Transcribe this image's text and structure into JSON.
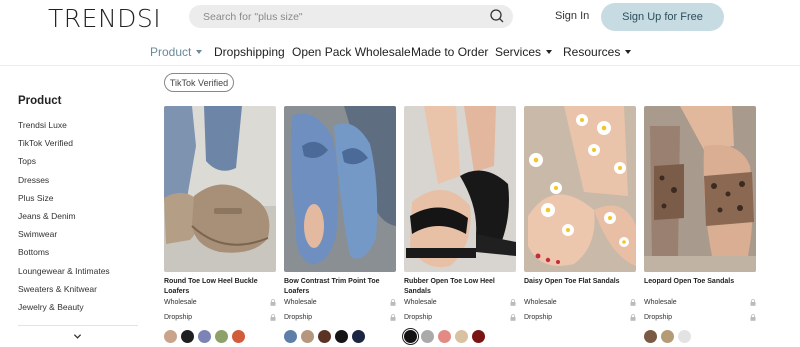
{
  "header": {
    "logo": "TRENDSI",
    "search_placeholder": "Search for \"plus size\"",
    "signin_label": "Sign In",
    "signup_label": "Sign Up for Free"
  },
  "nav": {
    "items": [
      {
        "label": "Product",
        "has_caret": true,
        "active": true
      },
      {
        "label": "Dropshipping",
        "has_caret": false
      },
      {
        "label": "Open Pack Wholesale",
        "has_caret": false
      },
      {
        "label": "Made to Order",
        "has_caret": false
      },
      {
        "label": "Services",
        "has_caret": true
      },
      {
        "label": "Resources",
        "has_caret": true
      }
    ]
  },
  "filter_chip": "TikTok Verified",
  "sidebar": {
    "title": "Product",
    "items": [
      "Trendsi Luxe",
      "TikTok Verified",
      "Tops",
      "Dresses",
      "Plus Size",
      "Jeans & Denim",
      "Swimwear",
      "Bottoms",
      "Loungewear & Intimates",
      "Sweaters & Knitwear",
      "Jewelry & Beauty"
    ]
  },
  "products": [
    {
      "title": "Round Toe Low Heel Buckle Loafers",
      "wholesale_label": "Wholesale",
      "dropship_label": "Dropship",
      "swatches": [
        "#c9a48a",
        "#1f1f1f",
        "#7b84b5",
        "#8da26a",
        "#d25c3a"
      ]
    },
    {
      "title": "Bow Contrast Trim Point Toe Loafers",
      "wholesale_label": "Wholesale",
      "dropship_label": "Dropship",
      "swatches": [
        "#5f7fa8",
        "#b5977e",
        "#5a3325",
        "#151515",
        "#1b2742"
      ]
    },
    {
      "title": "Rubber Open Toe Low Heel Sandals",
      "wholesale_label": "Wholesale",
      "dropship_label": "Dropship",
      "swatches": [
        "#131313",
        "#aaaaaa",
        "#e48a84",
        "#d8c2a2",
        "#7a1414"
      ]
    },
    {
      "title": "Daisy Open Toe Flat Sandals",
      "wholesale_label": "Wholesale",
      "dropship_label": "Dropship",
      "swatches": []
    },
    {
      "title": "Leopard Open Toe Sandals",
      "wholesale_label": "Wholesale",
      "dropship_label": "Dropship",
      "swatches": [
        "#7a5a44",
        "#b59a76",
        "#e3e3e3"
      ]
    }
  ],
  "colors": {
    "accent": "#6a8a99",
    "signup_bg": "#c7dbe2",
    "search_bg": "#ececec"
  }
}
